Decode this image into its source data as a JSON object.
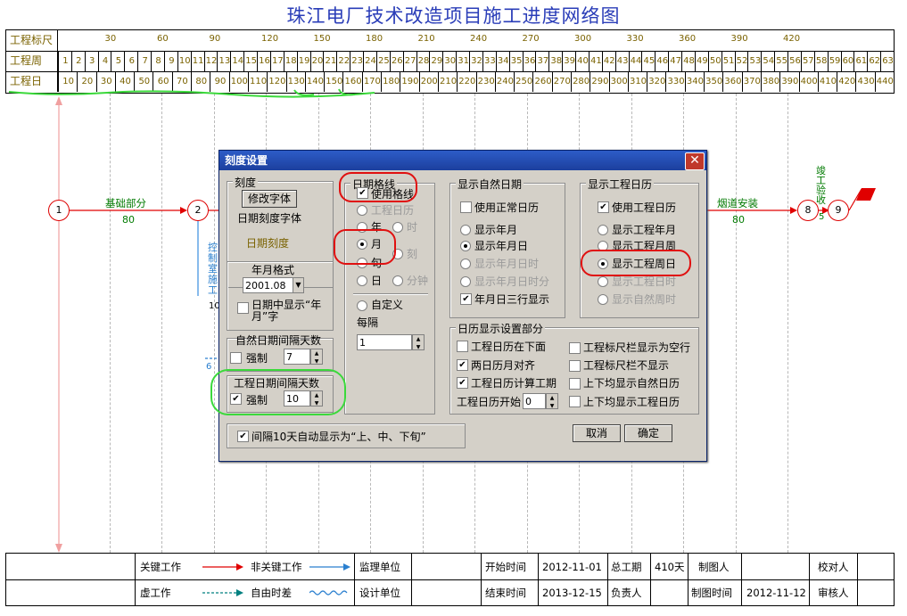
{
  "title": "珠江电厂技术改造项目施工进度网络图",
  "scale": {
    "row_labels": [
      "工程标尺",
      "工程周",
      "工程日"
    ],
    "ruler_ticks": [
      "30",
      "60",
      "90",
      "120",
      "150",
      "180",
      "210",
      "240",
      "270",
      "300",
      "330",
      "360",
      "390",
      "420"
    ],
    "weeks": [
      "1",
      "2",
      "3",
      "4",
      "5",
      "6",
      "7",
      "8",
      "9",
      "10",
      "11",
      "12",
      "13",
      "14",
      "15",
      "16",
      "17",
      "18",
      "19",
      "20",
      "21",
      "22",
      "23",
      "24",
      "25",
      "26",
      "27",
      "28",
      "29",
      "30",
      "31",
      "32",
      "33",
      "34",
      "35",
      "36",
      "37",
      "38",
      "39",
      "40",
      "41",
      "42",
      "43",
      "44",
      "45",
      "46",
      "47",
      "48",
      "49",
      "50",
      "51",
      "52",
      "53",
      "54",
      "55",
      "56",
      "57",
      "58",
      "59",
      "60",
      "61",
      "62",
      "63"
    ],
    "days": [
      "10",
      "20",
      "30",
      "40",
      "50",
      "60",
      "70",
      "80",
      "90",
      "100",
      "110",
      "120",
      "130",
      "140",
      "150",
      "160",
      "170",
      "180",
      "190",
      "200",
      "210",
      "220",
      "230",
      "240",
      "250",
      "260",
      "270",
      "280",
      "290",
      "300",
      "310",
      "320",
      "330",
      "340",
      "350",
      "360",
      "370",
      "380",
      "390",
      "400",
      "410",
      "420",
      "430",
      "440"
    ]
  },
  "network": {
    "nodes": [
      "1",
      "2",
      "8",
      "9"
    ],
    "activity1": {
      "name": "基础部分",
      "duration": "80"
    },
    "activity2": {
      "name": "烟道安装",
      "duration": "80"
    },
    "vertical_label_left": "控制室施工",
    "vertical_label_left_dur": "10",
    "side_num": "6",
    "vertical_label_right": "竣工验收",
    "vertical_label_right_dur": "5"
  },
  "dialog": {
    "title": "刻度设置",
    "scale_group": {
      "title": "刻度",
      "modify_font_button": "修改字体",
      "date_font_label": "日期刻度字体",
      "date_scale_sample": "日期刻度",
      "year_month_format_label": "年月格式",
      "year_month_format_value": "2001.08",
      "show_yearmonth_char": "日期中显示“年月”字",
      "natural_interval_label": "自然日期间隔天数",
      "natural_force": "强制",
      "natural_value": "7",
      "project_interval_label": "工程日期间隔天数",
      "project_force": "强制",
      "project_value": "10"
    },
    "grid_group": {
      "title": "日期格线",
      "use_grid": "使用格线",
      "proj_calendar": "工程日历",
      "opt_year": "年",
      "opt_hour": "时",
      "opt_month": "月",
      "opt_quarter": "刻",
      "opt_xun": "旬",
      "opt_day": "日",
      "opt_minute": "分钟",
      "custom": "自定义",
      "every": "每隔",
      "every_value": "1"
    },
    "natural_group": {
      "title": "显示自然日期",
      "use_normal": "使用正常日历",
      "ym": "显示年月",
      "ymd": "显示年月日",
      "ymdh": "显示年月日时",
      "ymdhm": "显示年月日时分",
      "three_rows": "年月日三行显示"
    },
    "proj_group": {
      "title": "显示工程日历",
      "use_proj": "使用工程日历",
      "pym": "显示工程年月",
      "pmw": "显示工程月周",
      "pwd": "显示工程周日",
      "pdh": "显示工程日时",
      "nwd": "显示自然周时"
    },
    "cal_group": {
      "title": "日历显示设置部分",
      "proj_below": "工程日历在下面",
      "align": "两日历月对齐",
      "calc_period": "工程日历计算工期",
      "start_label": "工程日历开始",
      "start_value": "0",
      "ruler_blank": "工程标尺栏显示为空行",
      "ruler_hide": "工程标尺栏不显示",
      "both_natural": "上下均显示自然日历",
      "both_proj": "上下均显示工程日历"
    },
    "auto_xun": "间隔10天自动显示为“上、中、下旬”",
    "cancel": "取消",
    "ok": "确定"
  },
  "legend": {
    "key_work": "关键工作",
    "nonkey_work": "非关键工作",
    "virtual_work": "虚工作",
    "free_float": "自由时差",
    "supervisor": "监理单位",
    "designer": "设计单位",
    "start_time_label": "开始时间",
    "start_time": "2012-11-01",
    "end_time_label": "结束时间",
    "end_time": "2013-12-15",
    "total_label": "总工期",
    "total": "410天",
    "owner_label": "负责人",
    "drawer_label": "制图人",
    "draw_time_label": "制图时间",
    "draw_time": "2012-11-12",
    "checker_label": "校对人",
    "reviewer_label": "审核人"
  }
}
